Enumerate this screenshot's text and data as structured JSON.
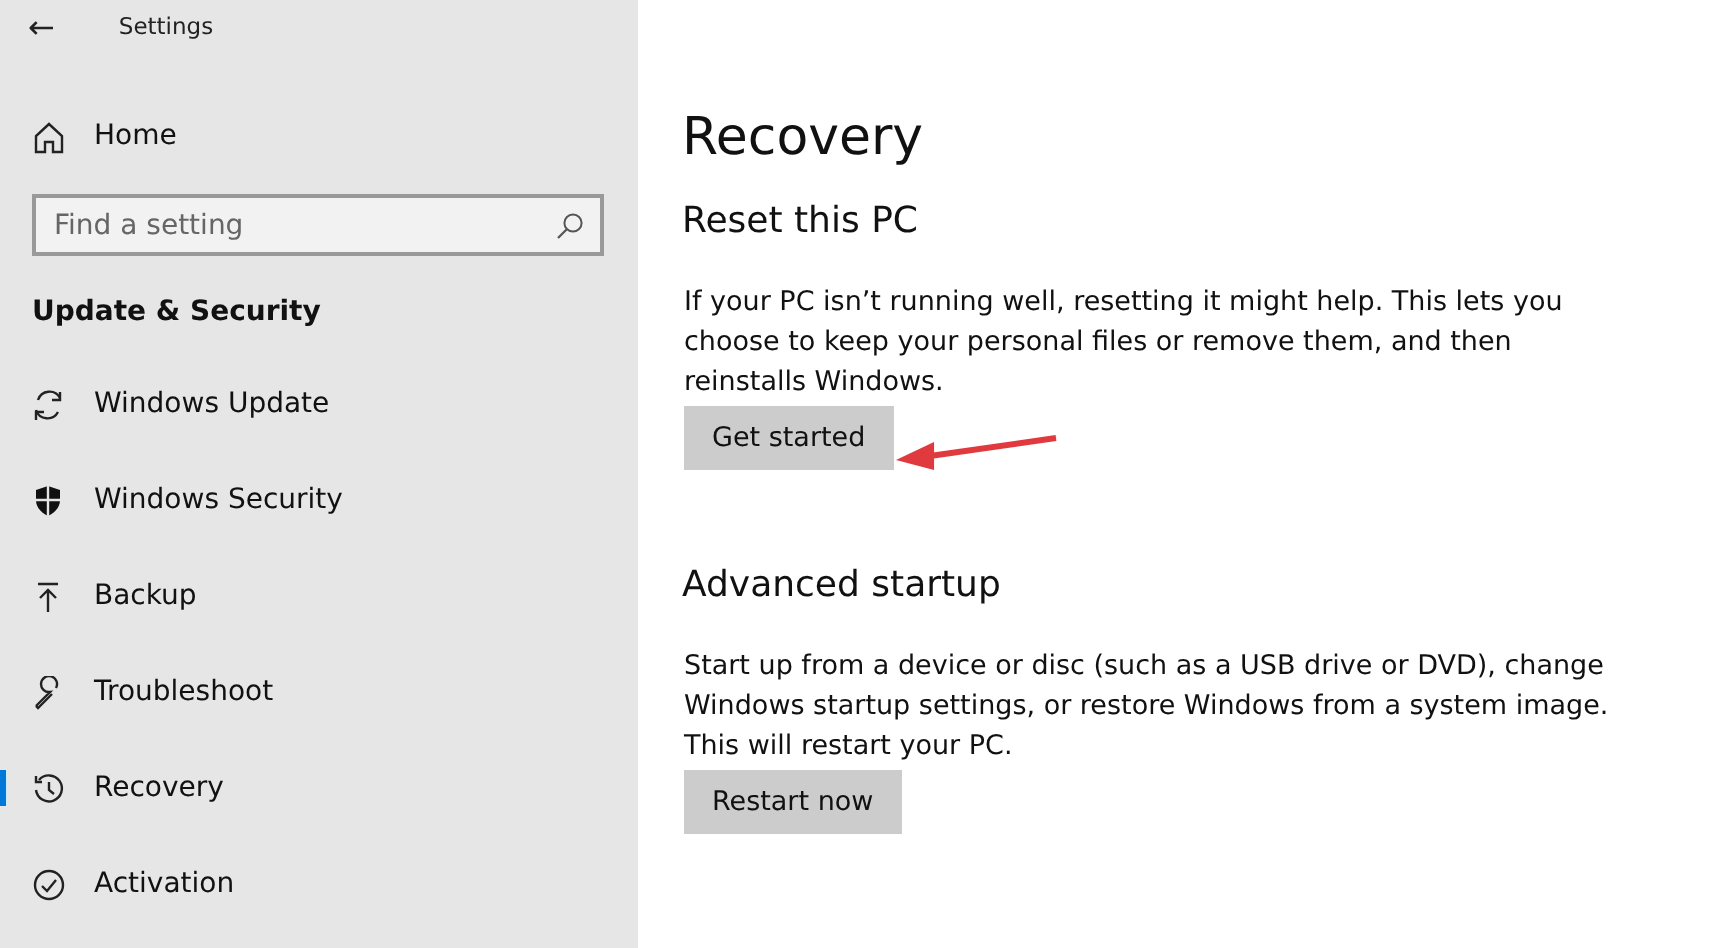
{
  "window": {
    "title": "Settings",
    "back_button": "←"
  },
  "sidebar": {
    "home": "Home",
    "search": {
      "placeholder": "Find a setting"
    },
    "section_title": "Update & Security",
    "items": [
      {
        "label": "Windows Update",
        "selected": false
      },
      {
        "label": "Windows Security",
        "selected": false
      },
      {
        "label": "Backup",
        "selected": false
      },
      {
        "label": "Troubleshoot",
        "selected": false
      },
      {
        "label": "Recovery",
        "selected": true
      },
      {
        "label": "Activation",
        "selected": false
      }
    ]
  },
  "page": {
    "title": "Recovery",
    "sections": [
      {
        "heading": "Reset this PC",
        "text": "If your PC isn’t running well, resetting it might help. This lets you choose to keep your personal files or remove them, and then reinstalls Windows.",
        "button": "Get started"
      },
      {
        "heading": "Advanced startup",
        "text": "Start up from a device or disc (such as a USB drive or DVD), change Windows startup settings, or restore Windows from a system image. This will restart your PC.",
        "button": "Restart now"
      }
    ]
  }
}
